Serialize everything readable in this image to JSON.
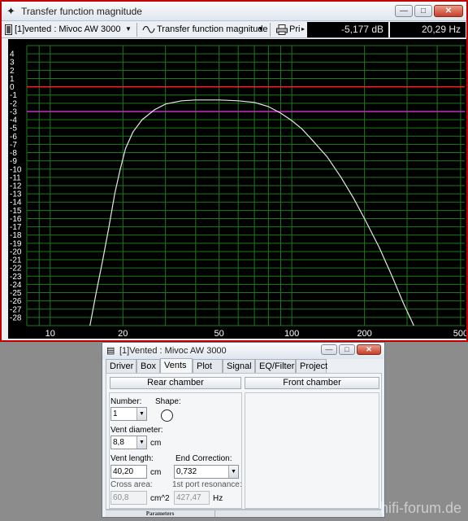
{
  "top_window": {
    "title": "Transfer function magnitude",
    "title_icon": "✦",
    "buttons": {
      "minimize": "—",
      "maximize": "□",
      "close": "✕"
    }
  },
  "toolbar": {
    "project_label": "[1]vented : Mivoc AW 3000",
    "view_label": "Transfer function magnitude",
    "print_label": "Pri",
    "readout_db": "-5,177 dB",
    "readout_hz": "20,29 Hz"
  },
  "chart_data": {
    "type": "line",
    "x_scale": "log",
    "xlim": [
      8,
      520
    ],
    "ylim": [
      -29,
      5
    ],
    "x_ticks": [
      10,
      20,
      50,
      100,
      200,
      500
    ],
    "x_tick_labels": [
      "10",
      "20",
      "50",
      "100",
      "200",
      "500"
    ],
    "y_tick_labels": [
      "4",
      "3",
      "2",
      "1",
      "0",
      "-1",
      "-2",
      "-3",
      "-4",
      "-5",
      "-6",
      "-7",
      "-8",
      "-9",
      "-10",
      "-11",
      "-12",
      "-13",
      "-14",
      "-15",
      "-16",
      "-17",
      "-18",
      "-19",
      "-20",
      "-21",
      "-22",
      "-23",
      "-24",
      "-25",
      "-26",
      "-27",
      "-28"
    ],
    "reference_lines": [
      {
        "y": 0,
        "color": "#ff2020"
      },
      {
        "y": -3,
        "color": "#c030c0"
      }
    ],
    "grid": true,
    "colors": {
      "background": "#000000",
      "grid": "#1d7a1d",
      "curve": "#e6e6e6",
      "axis_text": "#ffffff"
    },
    "series": [
      {
        "points": [
          [
            14.6,
            -29
          ],
          [
            15.5,
            -25
          ],
          [
            16.5,
            -21
          ],
          [
            17.5,
            -17
          ],
          [
            18.5,
            -13
          ],
          [
            19.5,
            -10
          ],
          [
            20.5,
            -7.5
          ],
          [
            22,
            -5.5
          ],
          [
            24,
            -4
          ],
          [
            27,
            -2.8
          ],
          [
            30,
            -2.1
          ],
          [
            35,
            -1.7
          ],
          [
            40,
            -1.6
          ],
          [
            50,
            -1.6
          ],
          [
            60,
            -1.7
          ],
          [
            70,
            -1.9
          ],
          [
            80,
            -2.4
          ],
          [
            90,
            -3.2
          ],
          [
            100,
            -4.1
          ],
          [
            110,
            -5.1
          ],
          [
            120,
            -6.3
          ],
          [
            140,
            -8.5
          ],
          [
            160,
            -11
          ],
          [
            180,
            -13.5
          ],
          [
            200,
            -16
          ],
          [
            230,
            -19.5
          ],
          [
            260,
            -23
          ],
          [
            290,
            -26.3
          ],
          [
            320,
            -29
          ]
        ]
      }
    ]
  },
  "dialog": {
    "title": "[1]Vented : Mivoc AW 3000",
    "title_icon": "▤",
    "tabs": [
      "Driver",
      "Box",
      "Vents",
      "Plot",
      "Signal",
      "EQ/Filter",
      "Project"
    ],
    "active_tab": "Vents",
    "rear_chamber": "Rear chamber",
    "front_chamber": "Front chamber",
    "number_label": "Number:",
    "number_value": "1",
    "shape_label": "Shape:",
    "shape_icon": "circle-icon",
    "vent_diameter_label": "Vent diameter:",
    "vent_diameter_value": "8,8",
    "vent_diameter_unit": "cm",
    "vent_length_label": "Vent length:",
    "vent_length_value": "40,20",
    "vent_length_unit": "cm",
    "end_correction_label": "End Correction:",
    "end_correction_value": "0,732",
    "cross_area_label": "Cross area:",
    "cross_area_value": "60,8",
    "cross_area_unit": "cm^2",
    "port_resonance_label": "1st port resonance:",
    "port_resonance_value": "427,47",
    "port_resonance_unit": "Hz",
    "status_label": "Parameters"
  },
  "watermark": "hifi-forum.de"
}
